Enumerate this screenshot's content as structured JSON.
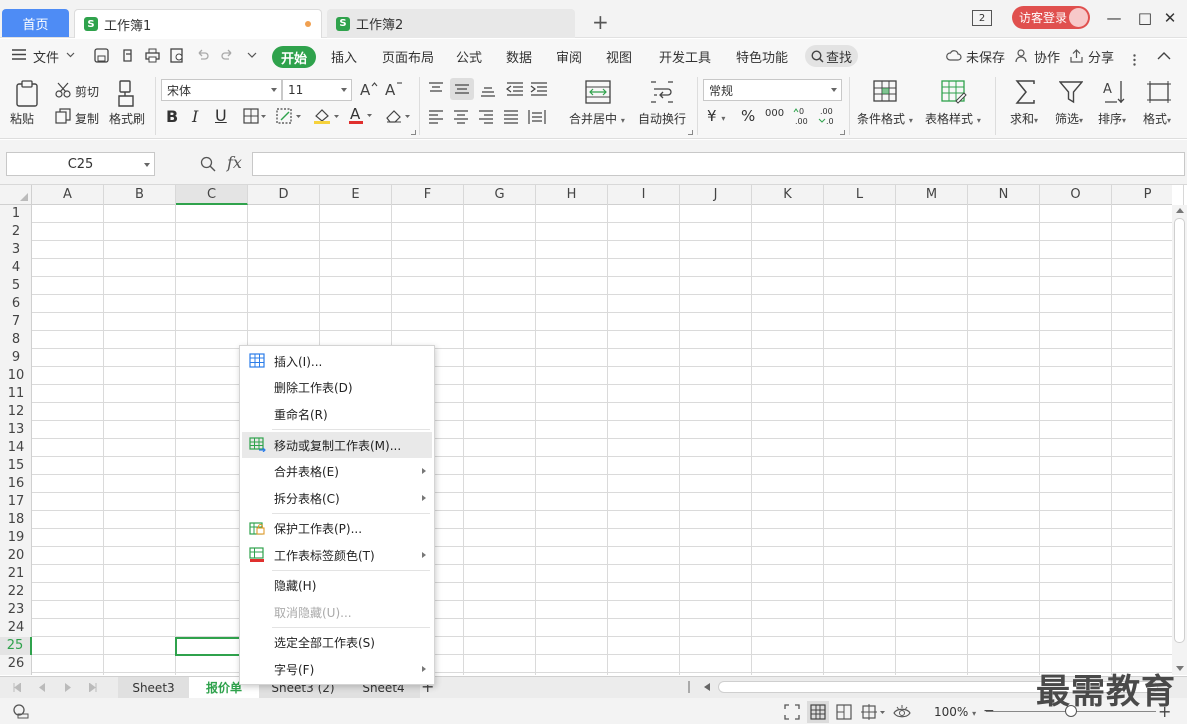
{
  "titlebar": {
    "home_tab": "首页",
    "workbook1": "工作簿1",
    "workbook2": "工作簿2",
    "new_tab": "+",
    "window_badge": "2",
    "login": "访客登录",
    "minimize": "—",
    "maximize": "□",
    "close": "✕"
  },
  "menu": {
    "file": "文件",
    "start": "开始",
    "items": [
      "插入",
      "页面布局",
      "公式",
      "数据",
      "审阅",
      "视图",
      "开发工具",
      "特色功能"
    ],
    "search": "查找",
    "unsaved": "未保存",
    "collab": "协作",
    "share": "分享"
  },
  "ribbon": {
    "paste": "粘贴",
    "cut": "剪切",
    "copy": "复制",
    "format_painter": "格式刷",
    "font_name": "宋体",
    "font_size": "11",
    "merge_center": "合并居中",
    "wrap_text": "自动换行",
    "number_format": "常规",
    "cond_format": "条件格式",
    "table_style": "表格样式",
    "sum": "求和",
    "filter": "筛选",
    "sort": "排序",
    "format": "格式"
  },
  "formula_bar": {
    "name_box": "C25",
    "fx": "fx",
    "value": ""
  },
  "grid": {
    "columns": [
      "A",
      "B",
      "C",
      "D",
      "E",
      "F",
      "G",
      "H",
      "I",
      "J",
      "K",
      "L",
      "M",
      "N",
      "O",
      "P"
    ],
    "selected_column": "C",
    "rows": [
      "1",
      "2",
      "3",
      "4",
      "5",
      "6",
      "7",
      "8",
      "9",
      "10",
      "11",
      "12",
      "13",
      "14",
      "15",
      "16",
      "17",
      "18",
      "19",
      "20",
      "21",
      "22",
      "23",
      "24",
      "25",
      "26"
    ],
    "selected_row": "25"
  },
  "context_menu": {
    "items": [
      {
        "label": "插入(I)...",
        "icon": "insert-table-icon"
      },
      {
        "label": "删除工作表(D)"
      },
      {
        "label": "重命名(R)"
      },
      {
        "label": "移动或复制工作表(M)...",
        "icon": "move-copy-sheet-icon",
        "highlighted": true
      },
      {
        "label": "合并表格(E)",
        "submenu": true
      },
      {
        "label": "拆分表格(C)",
        "submenu": true
      },
      {
        "label": "保护工作表(P)...",
        "icon": "protect-sheet-icon"
      },
      {
        "label": "工作表标签颜色(T)",
        "icon": "tab-color-icon",
        "submenu": true
      },
      {
        "label": "隐藏(H)"
      },
      {
        "label": "取消隐藏(U)...",
        "disabled": true
      },
      {
        "label": "选定全部工作表(S)"
      },
      {
        "label": "字号(F)",
        "submenu": true
      }
    ]
  },
  "sheets": {
    "tabs": [
      "Sheet3",
      "报价单",
      "Sheet3 (2)",
      "Sheet4"
    ],
    "active": "报价单",
    "add": "+"
  },
  "status": {
    "zoom": "100%",
    "zoom_level": 0.5
  },
  "watermark": "最需教育",
  "colors": {
    "accent_green": "#2fa24c",
    "home_blue": "#4e8cf5",
    "login_red": "#e0504e"
  }
}
